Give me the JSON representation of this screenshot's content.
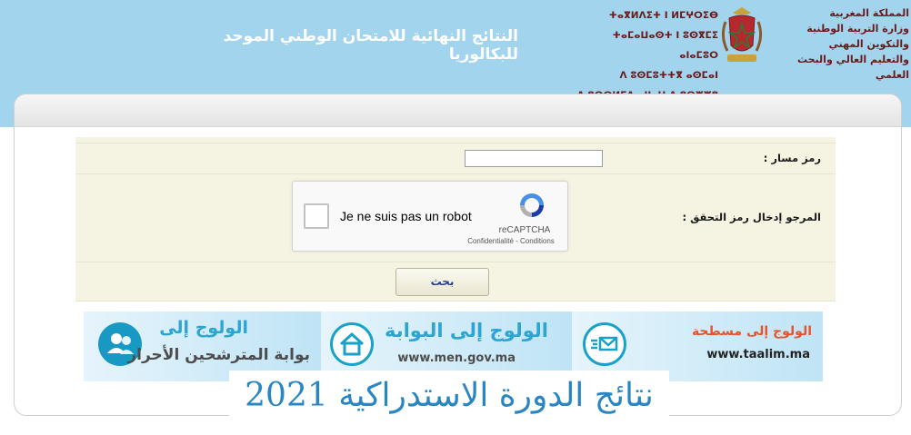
{
  "header": {
    "title": "النتائج النهائية للامتحان الوطني الموحد للبكالوريا",
    "ministry_tifinagh": [
      "ⵜⴰⴳⵍⴷⵉⵜ ⵏ ⵍⵎⵖⵔⵉⴱ",
      "ⵜⴰⵎⴰⵡⴰⵙⵜ ⵏ ⵓⵙⴳⵎⵉ ⴰⵏⴰⵎⵓⵔ",
      "ⴷ ⵓⵙⵎⵓⵜⵜⴳ ⴰⵙⵎⴰⵏ",
      "ⴷ ⵓⵙⵙⵍⵎⴷ ⴰⵏⵏⴰⵡ ⴷ ⵓⵔⵣⵣⵓ ⴰⵎⴰⵙⵙⴰⵏ"
    ],
    "ministry_arabic": [
      "المملكة المغربية",
      "وزارة التربية الوطنية",
      "والتكوين المهني",
      "والتعليم العالي والبحث العلمي"
    ]
  },
  "form": {
    "massar_label": "رمز مسار :",
    "massar_value": "",
    "captcha_prompt_label": "المرجو إدخال رمز التحقق :",
    "search_label": "بحث"
  },
  "recaptcha": {
    "checkbox_label": "Je ne suis pas un robot",
    "brand": "reCAPTCHA",
    "links": "Confidentialité - Conditions",
    "checked": false
  },
  "banners": [
    {
      "line1": "الولوج إلى",
      "line2": "بوابة المترشحين الأحرار",
      "icon": "users-icon"
    },
    {
      "line1": "الولوج إلى البوابة",
      "line2": "www.men.gov.ma",
      "icon": "home-icon"
    },
    {
      "line1": "الولوج إلى مسطحة",
      "line2": "www.taalim.ma",
      "icon": "mail-icon"
    }
  ],
  "session_title": "نتائج الدورة الاستدراكية 2021",
  "colors": {
    "header_bg": "#a3d4ee",
    "form_bg": "#f5f4e3",
    "banner_accent": "#2da5d0",
    "title_color": "#2a86c2",
    "taalim_orange": "#e7532b"
  }
}
